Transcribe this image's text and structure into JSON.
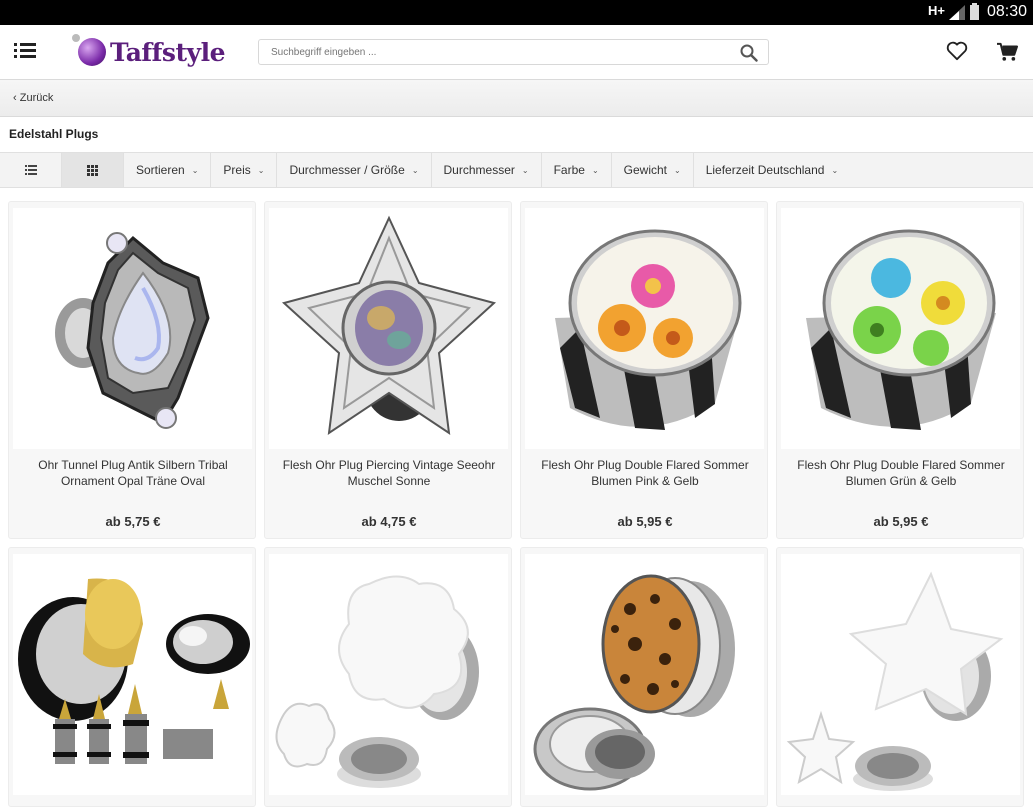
{
  "status_bar": {
    "network": "H+",
    "time": "08:30"
  },
  "header": {
    "logo_text": "Taffstyle",
    "search_placeholder": "Suchbegriff eingeben ...",
    "brand_color": "#5b1f7c"
  },
  "nav": {
    "back_label": "Zurück"
  },
  "category_title": "Edelstahl Plugs",
  "filters": [
    {
      "label": "Sortieren"
    },
    {
      "label": "Preis"
    },
    {
      "label": "Durchmesser / Größe"
    },
    {
      "label": "Durchmesser"
    },
    {
      "label": "Farbe"
    },
    {
      "label": "Gewicht"
    },
    {
      "label": "Lieferzeit Deutschland"
    }
  ],
  "view_modes": {
    "active": "grid",
    "options": [
      "list-icon",
      "grid-icon"
    ]
  },
  "products": [
    {
      "name": "Ohr Tunnel Plug Antik Silbern Tribal Ornament Opal Träne Oval",
      "price": "ab 5,75 €",
      "image": "opal-ornament-plug"
    },
    {
      "name": "Flesh Ohr Plug Piercing Vintage Seeohr Muschel Sonne",
      "price": "ab 4,75 €",
      "image": "abalone-flower-plug"
    },
    {
      "name": "Flesh Ohr Plug Double Flared Sommer Blumen Pink & Gelb",
      "price": "ab 5,95 €",
      "image": "pink-yellow-flower-plug"
    },
    {
      "name": "Flesh Ohr Plug Double Flared Sommer Blumen Grün & Gelb",
      "price": "ab 5,95 €",
      "image": "green-yellow-flower-plug"
    },
    {
      "name": "",
      "price": "",
      "image": "gold-spike-plug-set"
    },
    {
      "name": "",
      "price": "",
      "image": "white-flower-plug"
    },
    {
      "name": "",
      "price": "",
      "image": "leopard-plug"
    },
    {
      "name": "",
      "price": "",
      "image": "white-star-plug"
    }
  ]
}
